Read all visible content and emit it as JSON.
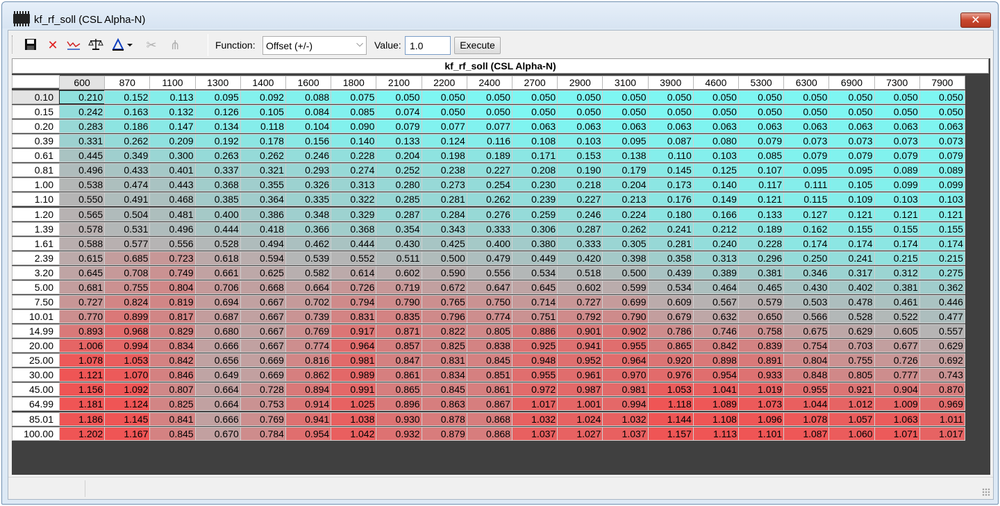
{
  "window": {
    "title": "kf_rf_soll (CSL Alpha-N)",
    "close_glyph": "✕"
  },
  "toolbar": {
    "icons": [
      "save-icon",
      "delete-icon",
      "graph-icon",
      "balance-icon",
      "interpolate-icon",
      "cut-icon",
      "merge-icon"
    ],
    "function_label": "Function:",
    "function_value": "Offset (+/-)",
    "value_label": "Value:",
    "value_input": "1.0",
    "execute_label": "Execute"
  },
  "table": {
    "caption": "kf_rf_soll (CSL Alpha-N)",
    "columns": [
      "600",
      "870",
      "1100",
      "1300",
      "1400",
      "1600",
      "1800",
      "2100",
      "2200",
      "2400",
      "2700",
      "2900",
      "3100",
      "3900",
      "4600",
      "5300",
      "6300",
      "6900",
      "7300",
      "7900"
    ],
    "rows": [
      {
        "label": "0.10",
        "values": [
          "0.210",
          "0.152",
          "0.113",
          "0.095",
          "0.092",
          "0.088",
          "0.075",
          "0.050",
          "0.050",
          "0.050",
          "0.050",
          "0.050",
          "0.050",
          "0.050",
          "0.050",
          "0.050",
          "0.050",
          "0.050",
          "0.050",
          "0.050"
        ]
      },
      {
        "label": "0.15",
        "values": [
          "0.242",
          "0.163",
          "0.132",
          "0.126",
          "0.105",
          "0.084",
          "0.085",
          "0.074",
          "0.050",
          "0.050",
          "0.050",
          "0.050",
          "0.050",
          "0.050",
          "0.050",
          "0.050",
          "0.050",
          "0.050",
          "0.050",
          "0.050"
        ]
      },
      {
        "label": "0.20",
        "values": [
          "0.283",
          "0.186",
          "0.147",
          "0.134",
          "0.118",
          "0.104",
          "0.090",
          "0.079",
          "0.077",
          "0.077",
          "0.063",
          "0.063",
          "0.063",
          "0.063",
          "0.063",
          "0.063",
          "0.063",
          "0.063",
          "0.063",
          "0.063"
        ]
      },
      {
        "label": "0.39",
        "values": [
          "0.331",
          "0.262",
          "0.209",
          "0.192",
          "0.178",
          "0.156",
          "0.140",
          "0.133",
          "0.124",
          "0.116",
          "0.108",
          "0.103",
          "0.095",
          "0.087",
          "0.080",
          "0.079",
          "0.073",
          "0.073",
          "0.073",
          "0.073"
        ]
      },
      {
        "label": "0.61",
        "values": [
          "0.445",
          "0.349",
          "0.300",
          "0.263",
          "0.262",
          "0.246",
          "0.228",
          "0.204",
          "0.198",
          "0.189",
          "0.171",
          "0.153",
          "0.138",
          "0.110",
          "0.103",
          "0.085",
          "0.079",
          "0.079",
          "0.079",
          "0.079"
        ]
      },
      {
        "label": "0.81",
        "values": [
          "0.496",
          "0.433",
          "0.401",
          "0.337",
          "0.321",
          "0.293",
          "0.274",
          "0.252",
          "0.238",
          "0.227",
          "0.208",
          "0.190",
          "0.179",
          "0.145",
          "0.125",
          "0.107",
          "0.095",
          "0.095",
          "0.089",
          "0.089"
        ]
      },
      {
        "label": "1.00",
        "values": [
          "0.538",
          "0.474",
          "0.443",
          "0.368",
          "0.355",
          "0.326",
          "0.313",
          "0.280",
          "0.273",
          "0.254",
          "0.230",
          "0.218",
          "0.204",
          "0.173",
          "0.140",
          "0.117",
          "0.111",
          "0.105",
          "0.099",
          "0.099"
        ]
      },
      {
        "label": "1.10",
        "values": [
          "0.550",
          "0.491",
          "0.468",
          "0.385",
          "0.364",
          "0.335",
          "0.322",
          "0.285",
          "0.281",
          "0.262",
          "0.239",
          "0.227",
          "0.213",
          "0.176",
          "0.149",
          "0.121",
          "0.115",
          "0.109",
          "0.103",
          "0.103"
        ]
      },
      {
        "label": "1.20",
        "values": [
          "0.565",
          "0.504",
          "0.481",
          "0.400",
          "0.386",
          "0.348",
          "0.329",
          "0.287",
          "0.284",
          "0.276",
          "0.259",
          "0.246",
          "0.224",
          "0.180",
          "0.166",
          "0.133",
          "0.127",
          "0.121",
          "0.121",
          "0.121"
        ]
      },
      {
        "label": "1.39",
        "values": [
          "0.578",
          "0.531",
          "0.496",
          "0.444",
          "0.418",
          "0.366",
          "0.368",
          "0.354",
          "0.343",
          "0.333",
          "0.306",
          "0.287",
          "0.262",
          "0.241",
          "0.212",
          "0.189",
          "0.162",
          "0.155",
          "0.155",
          "0.155"
        ]
      },
      {
        "label": "1.61",
        "values": [
          "0.588",
          "0.577",
          "0.556",
          "0.528",
          "0.494",
          "0.462",
          "0.444",
          "0.430",
          "0.425",
          "0.400",
          "0.380",
          "0.333",
          "0.305",
          "0.281",
          "0.240",
          "0.228",
          "0.174",
          "0.174",
          "0.174",
          "0.174"
        ]
      },
      {
        "label": "2.39",
        "values": [
          "0.615",
          "0.685",
          "0.723",
          "0.618",
          "0.594",
          "0.539",
          "0.552",
          "0.511",
          "0.500",
          "0.479",
          "0.449",
          "0.420",
          "0.398",
          "0.358",
          "0.313",
          "0.296",
          "0.250",
          "0.241",
          "0.215",
          "0.215"
        ]
      },
      {
        "label": "3.20",
        "values": [
          "0.645",
          "0.708",
          "0.749",
          "0.661",
          "0.625",
          "0.582",
          "0.614",
          "0.602",
          "0.590",
          "0.556",
          "0.534",
          "0.518",
          "0.500",
          "0.439",
          "0.389",
          "0.381",
          "0.346",
          "0.317",
          "0.312",
          "0.275"
        ]
      },
      {
        "label": "5.00",
        "values": [
          "0.681",
          "0.755",
          "0.804",
          "0.706",
          "0.668",
          "0.664",
          "0.726",
          "0.719",
          "0.672",
          "0.647",
          "0.645",
          "0.602",
          "0.599",
          "0.534",
          "0.464",
          "0.465",
          "0.430",
          "0.402",
          "0.381",
          "0.362"
        ]
      },
      {
        "label": "7.50",
        "values": [
          "0.727",
          "0.824",
          "0.819",
          "0.694",
          "0.667",
          "0.702",
          "0.794",
          "0.790",
          "0.765",
          "0.750",
          "0.714",
          "0.727",
          "0.699",
          "0.609",
          "0.567",
          "0.579",
          "0.503",
          "0.478",
          "0.461",
          "0.446"
        ]
      },
      {
        "label": "10.01",
        "values": [
          "0.770",
          "0.899",
          "0.817",
          "0.687",
          "0.667",
          "0.739",
          "0.831",
          "0.835",
          "0.796",
          "0.774",
          "0.751",
          "0.792",
          "0.790",
          "0.679",
          "0.632",
          "0.650",
          "0.566",
          "0.528",
          "0.522",
          "0.477"
        ]
      },
      {
        "label": "14.99",
        "values": [
          "0.893",
          "0.968",
          "0.829",
          "0.680",
          "0.667",
          "0.769",
          "0.917",
          "0.871",
          "0.822",
          "0.805",
          "0.886",
          "0.901",
          "0.902",
          "0.786",
          "0.746",
          "0.758",
          "0.675",
          "0.629",
          "0.605",
          "0.557"
        ]
      },
      {
        "label": "20.00",
        "values": [
          "1.006",
          "0.994",
          "0.834",
          "0.666",
          "0.667",
          "0.774",
          "0.964",
          "0.857",
          "0.825",
          "0.838",
          "0.925",
          "0.941",
          "0.955",
          "0.865",
          "0.842",
          "0.839",
          "0.754",
          "0.703",
          "0.677",
          "0.629"
        ]
      },
      {
        "label": "25.00",
        "values": [
          "1.078",
          "1.053",
          "0.842",
          "0.656",
          "0.669",
          "0.816",
          "0.981",
          "0.847",
          "0.831",
          "0.845",
          "0.948",
          "0.952",
          "0.964",
          "0.920",
          "0.898",
          "0.891",
          "0.804",
          "0.755",
          "0.726",
          "0.692"
        ]
      },
      {
        "label": "30.00",
        "values": [
          "1.121",
          "1.070",
          "0.846",
          "0.649",
          "0.669",
          "0.862",
          "0.989",
          "0.861",
          "0.834",
          "0.851",
          "0.955",
          "0.961",
          "0.970",
          "0.976",
          "0.954",
          "0.933",
          "0.848",
          "0.805",
          "0.777",
          "0.743"
        ]
      },
      {
        "label": "45.00",
        "values": [
          "1.156",
          "1.092",
          "0.807",
          "0.664",
          "0.728",
          "0.894",
          "0.991",
          "0.865",
          "0.845",
          "0.861",
          "0.972",
          "0.987",
          "0.981",
          "1.053",
          "1.041",
          "1.019",
          "0.955",
          "0.921",
          "0.904",
          "0.870"
        ]
      },
      {
        "label": "64.99",
        "values": [
          "1.181",
          "1.124",
          "0.825",
          "0.664",
          "0.753",
          "0.914",
          "1.025",
          "0.896",
          "0.863",
          "0.867",
          "1.017",
          "1.001",
          "0.994",
          "1.118",
          "1.089",
          "1.073",
          "1.044",
          "1.012",
          "1.009",
          "0.969"
        ]
      },
      {
        "label": "85.01",
        "values": [
          "1.186",
          "1.145",
          "0.841",
          "0.666",
          "0.769",
          "0.941",
          "1.038",
          "0.930",
          "0.878",
          "0.868",
          "1.032",
          "1.024",
          "1.032",
          "1.144",
          "1.108",
          "1.096",
          "1.078",
          "1.057",
          "1.063",
          "1.011"
        ]
      },
      {
        "label": "100.00",
        "values": [
          "1.202",
          "1.167",
          "0.845",
          "0.670",
          "0.784",
          "0.954",
          "1.042",
          "0.932",
          "0.879",
          "0.868",
          "1.037",
          "1.027",
          "1.037",
          "1.157",
          "1.113",
          "1.101",
          "1.087",
          "1.060",
          "1.071",
          "1.017"
        ]
      }
    ]
  },
  "colors": {
    "low": "#7ef6f2",
    "mid": "#b5b5b5",
    "high": "#ef5555"
  }
}
